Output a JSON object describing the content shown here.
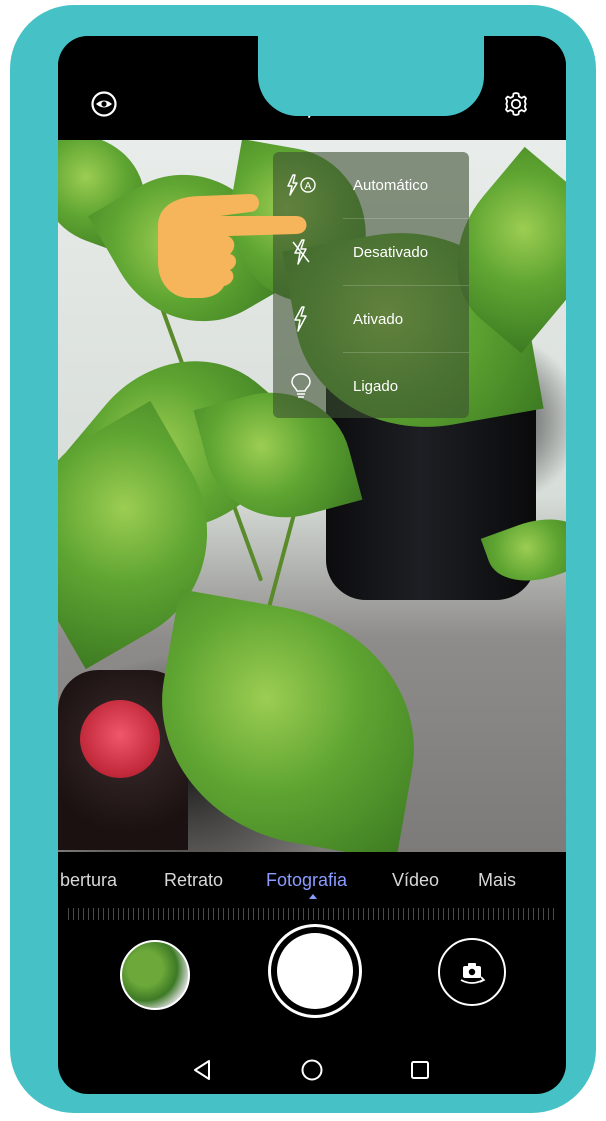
{
  "flash_menu": {
    "items": [
      {
        "label": "Automático",
        "icon": "flash-auto-icon"
      },
      {
        "label": "Desativado",
        "icon": "flash-off-icon"
      },
      {
        "label": "Ativado",
        "icon": "flash-on-icon"
      },
      {
        "label": "Ligado",
        "icon": "torch-bulb-icon"
      }
    ]
  },
  "modes": {
    "items": [
      "bertura",
      "Retrato",
      "Fotografia",
      "Vídeo",
      "Mais"
    ],
    "active": "Fotografia"
  },
  "colors": {
    "frame": "#46c2c6",
    "active_mode": "#8a9cff",
    "pointer_hand": "#f6b55a"
  },
  "top_icons": [
    "ai-lens-icon",
    "flash-off-icon",
    "settings-gear-icon"
  ],
  "bottom_icons": [
    "gallery-thumbnail",
    "shutter-button",
    "switch-camera-icon"
  ],
  "nav_icons": [
    "back-icon",
    "home-icon",
    "recents-icon"
  ]
}
